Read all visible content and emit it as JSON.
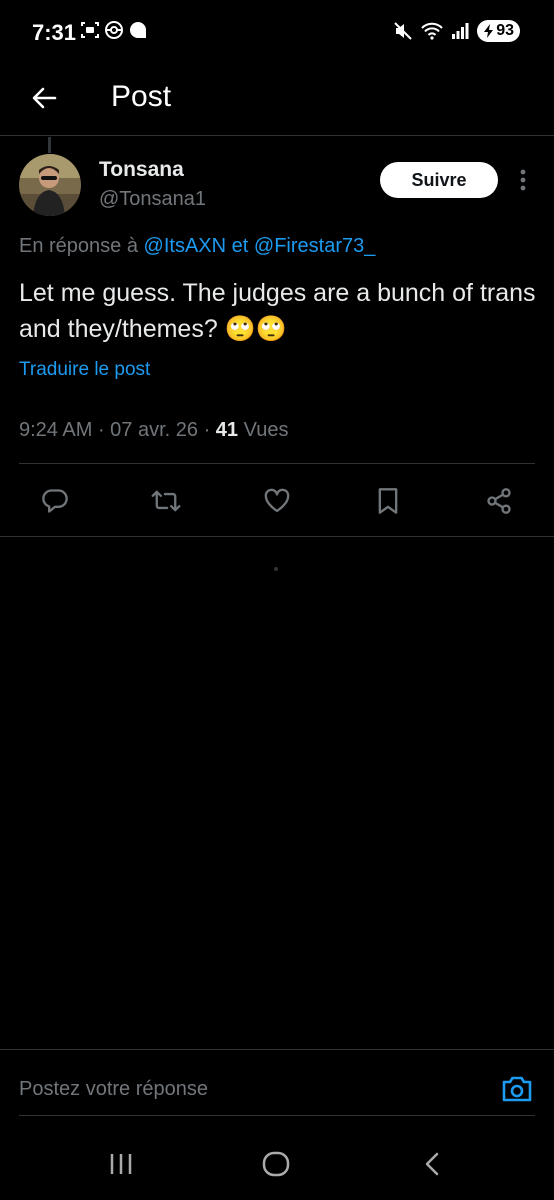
{
  "status_bar": {
    "time": "7:31",
    "battery": "93",
    "icons_left": [
      "screenshot-icon",
      "pokeball-icon",
      "chat-bubble-icon"
    ],
    "icons_right": [
      "mute-icon",
      "wifi-icon",
      "signal-icon",
      "battery-icon"
    ]
  },
  "header": {
    "title": "Post",
    "back_icon": "back-arrow-icon"
  },
  "post": {
    "author_name": "Tonsana",
    "author_handle": "@Tonsana1",
    "follow_label": "Suivre",
    "reply_prefix": "En réponse à",
    "mention_1": "@ItsAXN",
    "reply_conjunction": "et",
    "mention_2": "@Firestar73_",
    "body_text": "Let me guess. The judges are a bunch of trans and they/themes? 🙄🙄",
    "translate_label": "Traduire le post",
    "time": "9:24 AM",
    "date": "07 avr. 26",
    "views_count": "41",
    "views_label": "Vues"
  },
  "actions": [
    "reply-icon",
    "retweet-icon",
    "like-icon",
    "bookmark-icon",
    "share-icon"
  ],
  "reply_composer": {
    "placeholder": "Postez votre réponse",
    "camera_icon": "camera-icon"
  },
  "system_nav": [
    "recents-icon",
    "home-icon",
    "back-icon"
  ],
  "colors": {
    "background": "#000000",
    "text_primary": "#e7e9ea",
    "text_secondary": "#71767b",
    "accent": "#1d9bf0",
    "divider": "#2f3336"
  }
}
